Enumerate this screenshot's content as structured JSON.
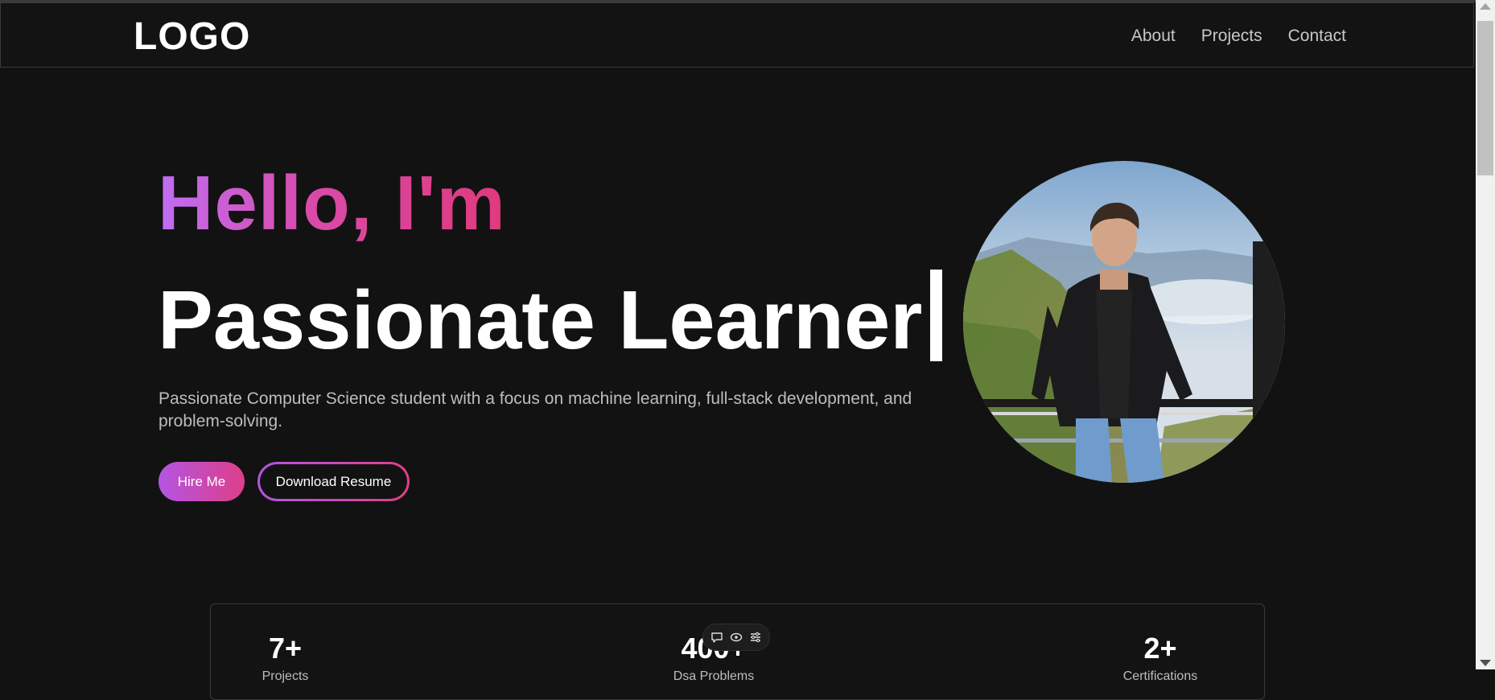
{
  "header": {
    "logo": "LOGO",
    "nav": [
      {
        "label": "About"
      },
      {
        "label": "Projects"
      },
      {
        "label": "Contact"
      }
    ]
  },
  "hero": {
    "greeting": "Hello, I'm",
    "title": "Passionate Learner",
    "description": "Passionate Computer Science student with a focus on machine learning, full-stack development, and problem-solving.",
    "primary_button": "Hire Me",
    "secondary_button": "Download Resume"
  },
  "stats": [
    {
      "value": "7+",
      "label": "Projects"
    },
    {
      "value": "400+",
      "label": "Dsa Problems"
    },
    {
      "value": "2+",
      "label": "Certifications"
    }
  ],
  "colors": {
    "background": "#121212",
    "accent_start": "#b455e3",
    "accent_end": "#dd3f87"
  },
  "icons": {
    "overlay": [
      "comment-icon",
      "eye-icon",
      "sliders-icon"
    ]
  }
}
